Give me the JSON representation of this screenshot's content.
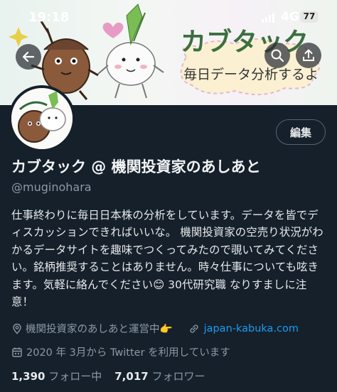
{
  "status_bar": {
    "time": "19:18",
    "network": "4G",
    "battery": "77"
  },
  "banner": {
    "title_text": "カブタック",
    "subtitle_text": "毎日データ分析するよ"
  },
  "header": {
    "edit_label": "編集"
  },
  "profile": {
    "display_name": "カブタック @ 機関投資家のあしあと",
    "handle": "@muginohara",
    "bio": "仕事終わりに毎日日本株の分析をしています。データを皆でディスカッションできればいいな。 機関投資家の空売り状況がわかるデータサイトを趣味でつくってみたので覗いてみてください。銘柄推奨することはありません。時々仕事についても呟きます。気軽に絡んでください😊 30代研究職 なりすましに注意！",
    "location": "機関投資家のあしあと運営中👉",
    "website": "japan-kabuka.com",
    "joined": "2020 年 3月から Twitter を利用しています",
    "following_count": "1,390",
    "following_label": "フォロー中",
    "followers_count": "7,017",
    "followers_label": "フォロワー"
  },
  "icons": [
    "back-arrow-icon",
    "search-icon",
    "share-icon",
    "location-pin-icon",
    "link-icon",
    "calendar-icon"
  ]
}
